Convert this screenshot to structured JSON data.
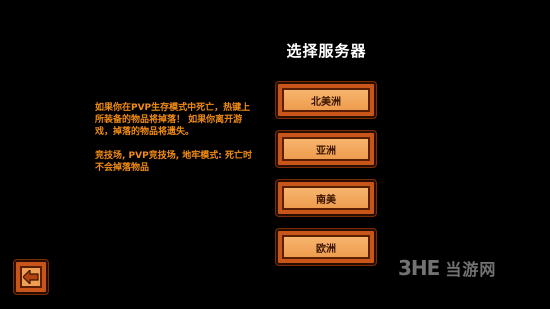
{
  "screen": {
    "title": "选择服务器"
  },
  "info": {
    "paragraph1": "如果你在PVP生存模式中死亡，热键上所装备的物品将掉落！ 如果你离开游戏，掉落的物品将遗失。",
    "paragraph2": "竞技场, PVP竞技场, 地牢模式: 死亡时不会掉落物品"
  },
  "servers": [
    {
      "label": "北美洲"
    },
    {
      "label": "亚洲"
    },
    {
      "label": "南美"
    },
    {
      "label": "欧洲"
    }
  ],
  "back_button": {
    "icon": "left-arrow-icon"
  },
  "watermark": {
    "logo": "3HE",
    "text": "当游网"
  },
  "colors": {
    "background": "#000000",
    "info_text": "#f28c12",
    "button_face": "#ef9f52",
    "button_frame": "#c8551a",
    "button_text": "#3b1500"
  }
}
